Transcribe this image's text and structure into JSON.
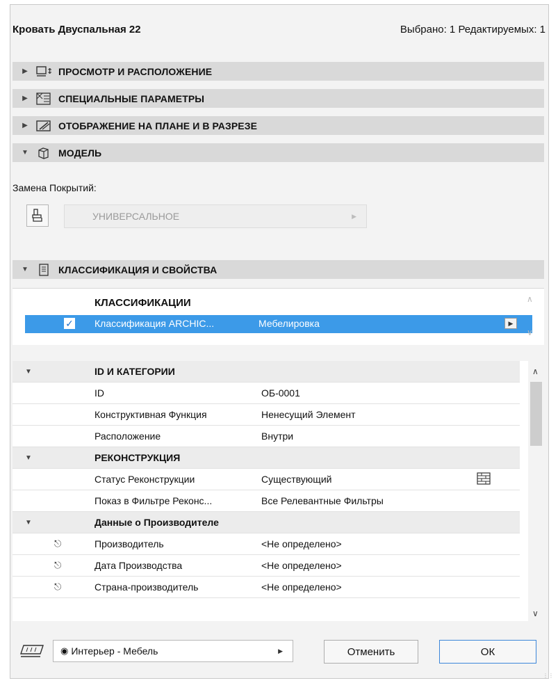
{
  "header": {
    "title": "Кровать Двуспальная 22",
    "selection_info": "Выбрано: 1 Редактируемых: 1"
  },
  "sections": [
    {
      "label": "ПРОСМОТР И РАСПОЛОЖЕНИЕ",
      "icon": "view-position-icon",
      "expanded": false
    },
    {
      "label": "СПЕЦИАЛЬНЫЕ ПАРАМЕТРЫ",
      "icon": "custom-params-icon",
      "expanded": false
    },
    {
      "label": "ОТОБРАЖЕНИЕ НА ПЛАНЕ И В РАЗРЕЗЕ",
      "icon": "plan-section-icon",
      "expanded": false
    },
    {
      "label": "МОДЕЛЬ",
      "icon": "model-cube-icon",
      "expanded": true
    },
    {
      "label": "КЛАССИФИКАЦИЯ И СВОЙСТВА",
      "icon": "classification-icon",
      "expanded": true
    }
  ],
  "model": {
    "override_label": "Замена Покрытий:",
    "material_value": "УНИВЕРСАЛЬНОЕ"
  },
  "classification": {
    "header": "КЛАССИФИКАЦИИ",
    "row": {
      "name": "Классификация ARCHIC...",
      "value": "Мебелировка",
      "checked": true
    }
  },
  "properties": {
    "groups": [
      {
        "label": "ID И КАТЕГОРИИ",
        "rows": [
          {
            "name": "ID",
            "value": "ОБ-0001"
          },
          {
            "name": "Конструктивная Функция",
            "value": "Ненесущий Элемент"
          },
          {
            "name": "Расположение",
            "value": "Внутри"
          }
        ]
      },
      {
        "label": "РЕКОНСТРУКЦИЯ",
        "rows": [
          {
            "name": "Статус Реконструкции",
            "value": "Существующий"
          },
          {
            "name": "Показ в Фильтре Реконс...",
            "value": "Все Релевантные Фильтры"
          }
        ]
      },
      {
        "label": "Данные о Производителе",
        "rows": [
          {
            "name": "Производитель",
            "value": "<Не определено>"
          },
          {
            "name": "Дата Производства",
            "value": "<Не определено>"
          },
          {
            "name": "Страна-производитель",
            "value": "<Не определено>"
          }
        ]
      }
    ]
  },
  "footer": {
    "layer_value": "Интерьер - Мебель",
    "cancel_label": "Отменить",
    "ok_label": "ОК"
  },
  "colors": {
    "selection": "#3c9ae8",
    "section_bar": "#d9d9d9",
    "dialog_bg": "#f3f3f3"
  }
}
